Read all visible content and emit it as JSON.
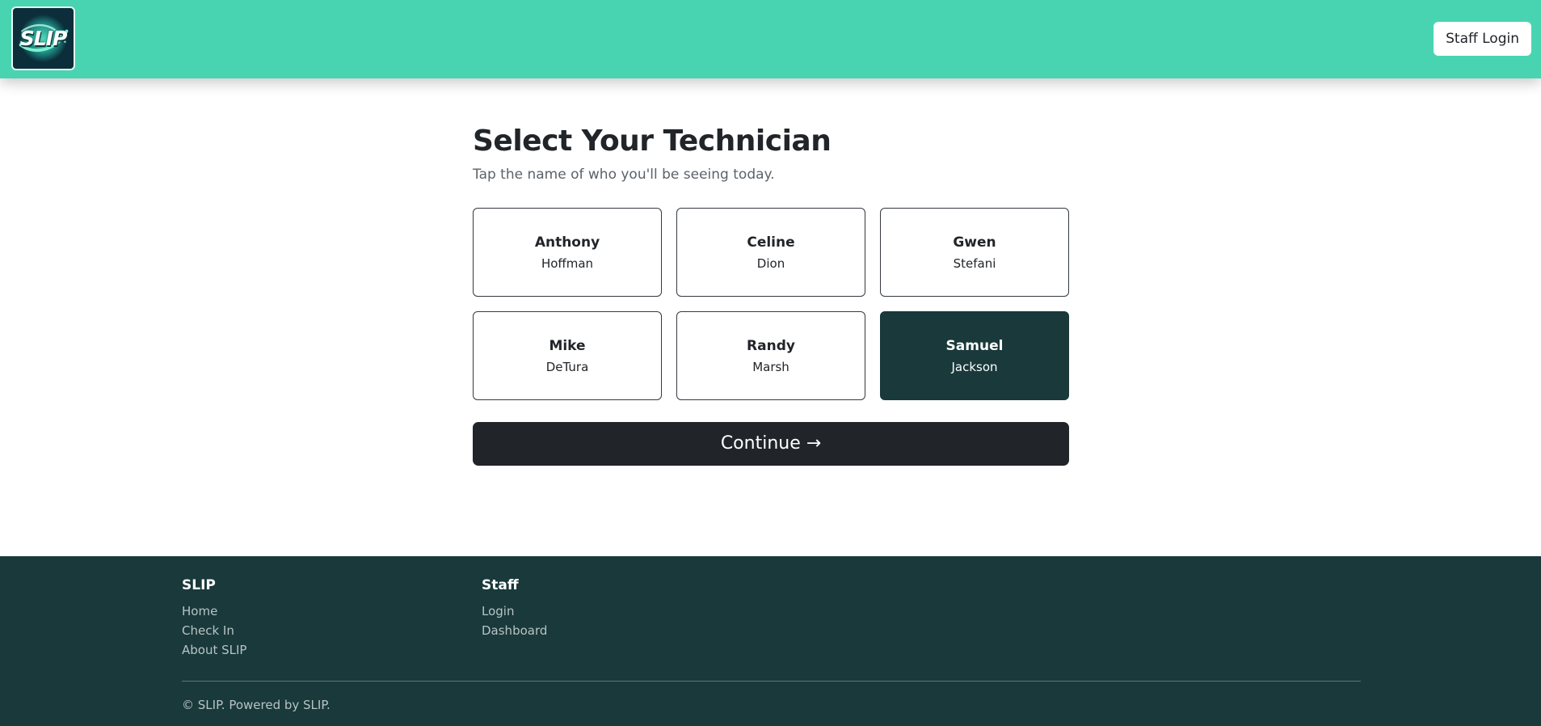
{
  "header": {
    "logo_text": "SLIP",
    "staff_login_label": "Staff Login"
  },
  "main": {
    "title": "Select Your Technician",
    "subtitle": "Tap the name of who you'll be seeing today.",
    "technicians": [
      {
        "first": "Anthony",
        "last": "Hoffman",
        "selected": false
      },
      {
        "first": "Celine",
        "last": "Dion",
        "selected": false
      },
      {
        "first": "Gwen",
        "last": "Stefani",
        "selected": false
      },
      {
        "first": "Mike",
        "last": "DeTura",
        "selected": false
      },
      {
        "first": "Randy",
        "last": "Marsh",
        "selected": false
      },
      {
        "first": "Samuel",
        "last": "Jackson",
        "selected": true
      }
    ],
    "continue_label": "Continue →"
  },
  "footer": {
    "columns": [
      {
        "heading": "SLIP",
        "links": [
          "Home",
          "Check In",
          "About SLIP"
        ]
      },
      {
        "heading": "Staff",
        "links": [
          "Login",
          "Dashboard"
        ]
      }
    ],
    "copyright": "© SLIP. Powered by SLIP."
  },
  "colors": {
    "header_bg": "#48d4b1",
    "footer_bg": "#19393a",
    "selected_card_bg": "#19393a",
    "continue_bg": "#212529",
    "logo_bg": "#0c2e3b"
  }
}
